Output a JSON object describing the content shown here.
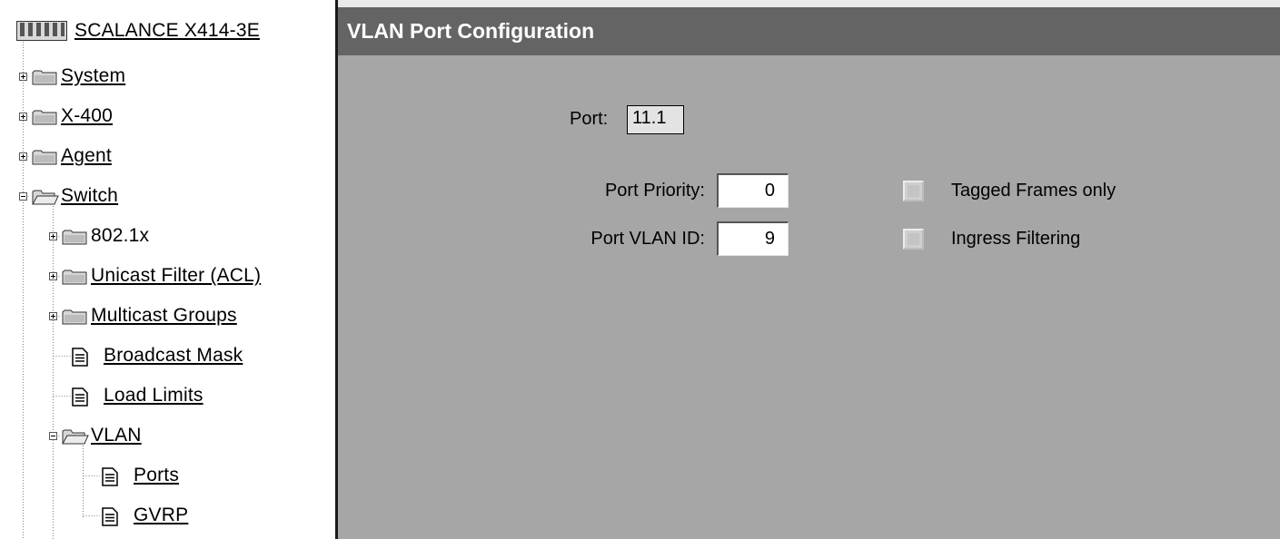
{
  "tree": {
    "root": {
      "label": "SCALANCE X414-3E",
      "icon": "device-rack-icon"
    },
    "items": [
      {
        "label": "System",
        "icon": "folder-icon",
        "expander": "plus"
      },
      {
        "label": "X-400",
        "icon": "folder-icon",
        "expander": "plus"
      },
      {
        "label": "Agent",
        "icon": "folder-icon",
        "expander": "plus"
      },
      {
        "label": "Switch",
        "icon": "folder-open-icon",
        "expander": "minus"
      },
      {
        "label": "802.1x",
        "icon": "folder-icon",
        "expander": "plus"
      },
      {
        "label": "Unicast Filter (ACL)",
        "icon": "folder-icon",
        "expander": "plus"
      },
      {
        "label": "Multicast Groups",
        "icon": "folder-icon",
        "expander": "plus"
      },
      {
        "label": "Broadcast Mask",
        "icon": "document-icon",
        "expander": "none"
      },
      {
        "label": "Load Limits",
        "icon": "document-icon",
        "expander": "none"
      },
      {
        "label": "VLAN",
        "icon": "folder-open-icon",
        "expander": "minus"
      },
      {
        "label": "Ports",
        "icon": "document-icon",
        "expander": "none"
      },
      {
        "label": "GVRP",
        "icon": "document-icon",
        "expander": "none"
      }
    ]
  },
  "page": {
    "title": "VLAN Port Configuration"
  },
  "form": {
    "port_label": "Port:",
    "port_value": "11.1",
    "priority_label": "Port Priority:",
    "priority_value": "0",
    "vlan_id_label": "Port VLAN ID:",
    "vlan_id_value": "9",
    "tagged_label": "Tagged Frames only",
    "tagged_checked": false,
    "ingress_label": "Ingress Filtering",
    "ingress_checked": false
  },
  "colors": {
    "panel_background": "#a6a6a6",
    "title_bar": "#646464",
    "title_text": "#ffffff"
  }
}
